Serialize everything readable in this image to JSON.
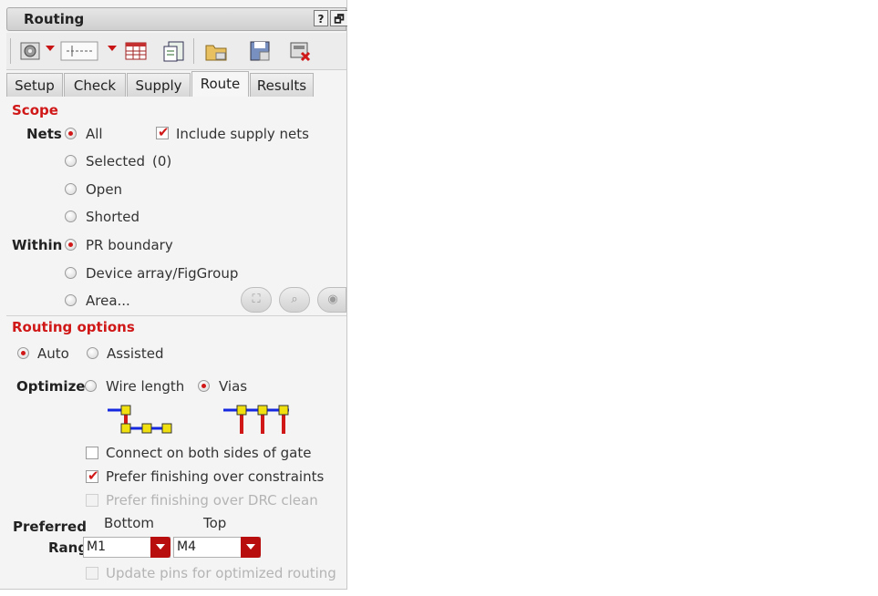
{
  "window": {
    "title": "Routing",
    "help_btn": "?",
    "float_btn": "🗗"
  },
  "toolbar": {
    "icons": [
      "route-settings-icon",
      "route-net-icon",
      "table-icon",
      "report-icon",
      "open-folder-icon",
      "save-icon",
      "delete-icon"
    ]
  },
  "tabs": [
    "Setup",
    "Check",
    "Supply",
    "Route",
    "Results"
  ],
  "active_tab": "Route",
  "scope": {
    "title": "Scope",
    "nets_label": "Nets",
    "nets_options": [
      "All",
      "Selected",
      "Open",
      "Shorted"
    ],
    "nets_selected": "All",
    "selected_count": "(0)",
    "include_supply_label": "Include supply nets",
    "include_supply_checked": true,
    "within_label": "Within",
    "within_options": [
      "PR boundary",
      "Device array/FigGroup",
      "Area..."
    ],
    "within_selected": "PR boundary"
  },
  "routing_options": {
    "title": "Routing options",
    "mode_options": [
      "Auto",
      "Assisted"
    ],
    "mode_selected": "Auto",
    "optimize_label": "Optimize",
    "optimize_options": [
      "Wire length",
      "Vias"
    ],
    "optimize_selected": "Vias",
    "checkboxes": [
      {
        "label": "Connect on both sides of gate",
        "checked": false,
        "enabled": true
      },
      {
        "label": "Prefer finishing over constraints",
        "checked": true,
        "enabled": true
      },
      {
        "label": "Prefer finishing over DRC clean",
        "checked": false,
        "enabled": false
      }
    ],
    "preferred_label_1": "Preferred",
    "preferred_label_2": "Range",
    "bottom_label": "Bottom",
    "top_label": "Top",
    "bottom_value": "M1",
    "top_value": "M4",
    "update_pins_label": "Update pins for optimized routing",
    "update_pins_enabled": false
  },
  "colors": {
    "accent": "#d01818",
    "wire": "#1428e0",
    "via": "#f0e010"
  }
}
